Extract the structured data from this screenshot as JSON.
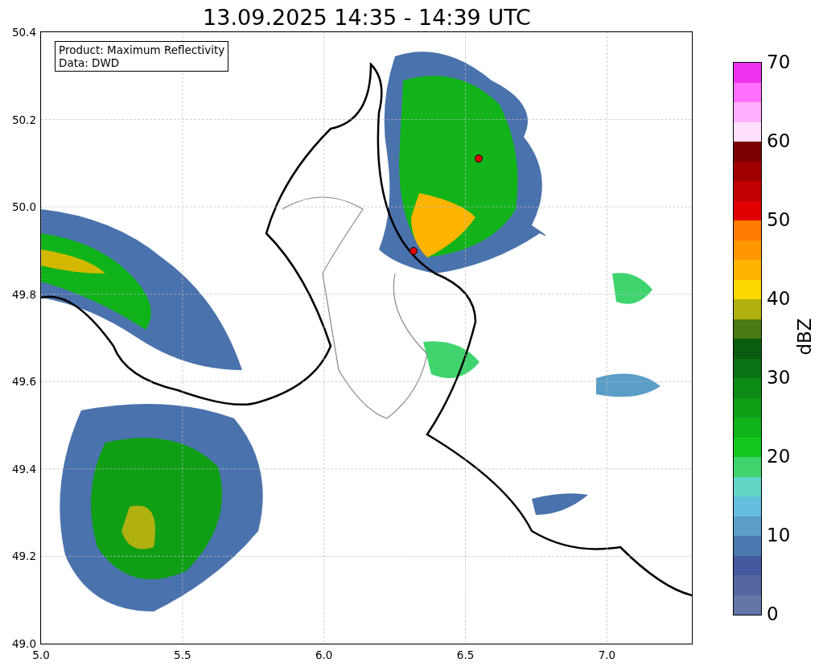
{
  "title": "13.09.2025 14:35 - 14:39 UTC",
  "legend": [
    "Product: Maximum Reflectivity",
    "Data: DWD"
  ],
  "x_ticks": [
    "5.0",
    "5.5",
    "6.0",
    "6.5",
    "7.0"
  ],
  "y_ticks": [
    "50.4",
    "50.2",
    "50.0",
    "49.8",
    "49.6",
    "49.4",
    "49.2",
    "49.0"
  ],
  "colorbar": {
    "label": "dBZ",
    "ticks": [
      "70",
      "60",
      "50",
      "40",
      "30",
      "20",
      "10",
      "0"
    ]
  }
}
